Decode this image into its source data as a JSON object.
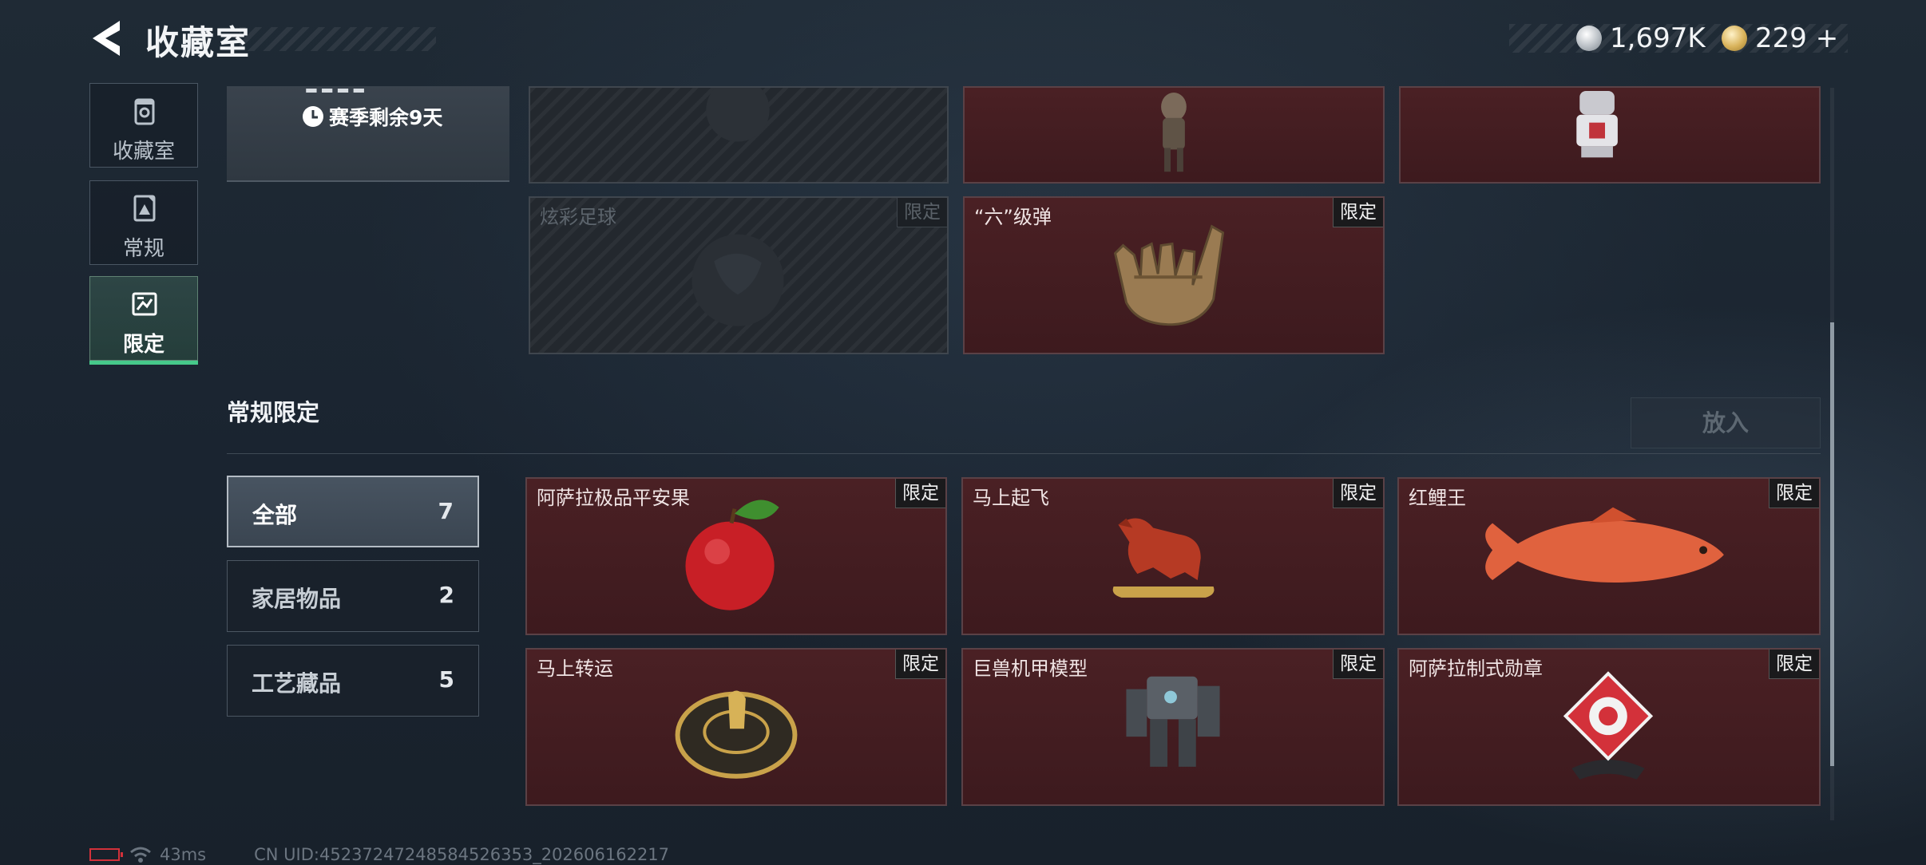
{
  "header": {
    "title": "收藏室",
    "currencies": [
      {
        "icon": "silver-coin-icon",
        "value": "1,697K"
      },
      {
        "icon": "gold-coin-icon",
        "value": "229 +"
      }
    ]
  },
  "nav": {
    "tabs": [
      {
        "label": "收藏室",
        "icon": "collection-room-icon"
      },
      {
        "label": "常规",
        "icon": "regular-icon"
      },
      {
        "label": "限定",
        "icon": "limited-icon",
        "active": true
      }
    ]
  },
  "season": {
    "remaining": "赛季剩余9天"
  },
  "top_items": [
    {
      "name": "",
      "tag": "",
      "locked": true
    },
    {
      "name": "",
      "tag": "",
      "locked": false
    },
    {
      "name": "",
      "tag": "",
      "locked": false
    },
    {
      "name": "炫彩足球",
      "tag": "限定",
      "locked": true
    },
    {
      "name": "“六”级弹",
      "tag": "限定",
      "locked": false
    }
  ],
  "section": {
    "title": "常规限定",
    "place_button": "放入"
  },
  "filters": [
    {
      "label": "全部",
      "count": "7",
      "active": true
    },
    {
      "label": "家居物品",
      "count": "2"
    },
    {
      "label": "工艺藏品",
      "count": "5"
    }
  ],
  "items": [
    {
      "name": "阿萨拉极品平安果",
      "tag": "限定",
      "icon": "apple-icon"
    },
    {
      "name": "马上起飞",
      "tag": "限定",
      "icon": "horse-statue-icon"
    },
    {
      "name": "红鲤王",
      "tag": "限定",
      "icon": "carp-icon"
    },
    {
      "name": "马上转运",
      "tag": "限定",
      "icon": "horse-medallion-icon"
    },
    {
      "name": "巨兽机甲模型",
      "tag": "限定",
      "icon": "mech-model-icon"
    },
    {
      "name": "阿萨拉制式勋章",
      "tag": "限定",
      "icon": "medal-icon"
    }
  ],
  "status_bar": {
    "ping": "43ms",
    "uid": "CN UID:45237247248584526353_202606162217"
  },
  "colors": {
    "accent_green": "#46c98a",
    "card_red": "#4a2024",
    "battery_red": "#d2313a"
  }
}
